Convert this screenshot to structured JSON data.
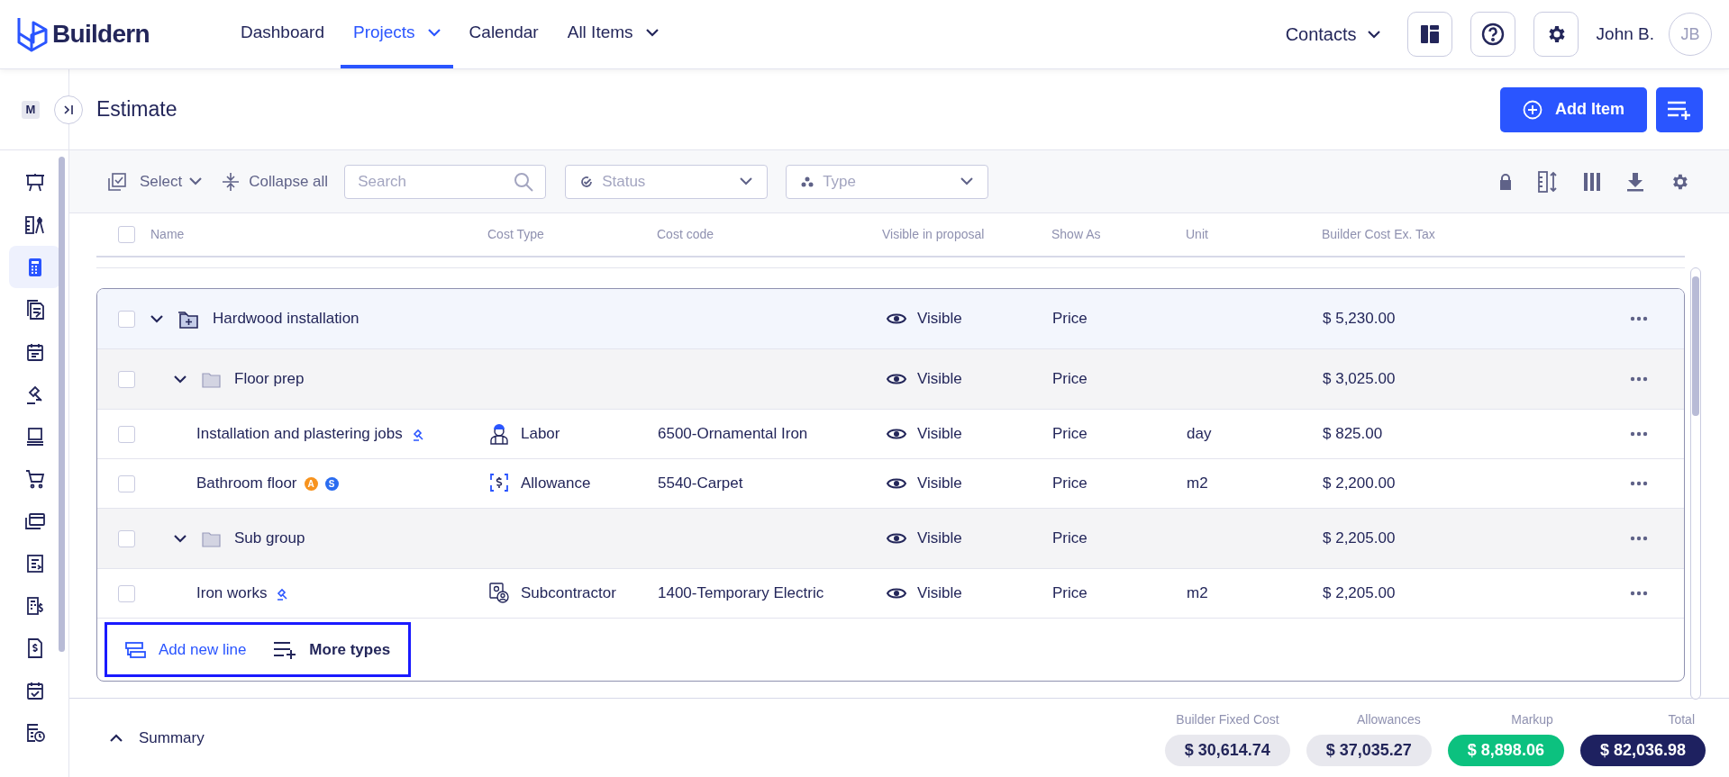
{
  "app": {
    "logo": "Buildern"
  },
  "nav": [
    {
      "label": "Dashboard",
      "selected": false,
      "dropdown": false
    },
    {
      "label": "Projects",
      "selected": true,
      "dropdown": true
    },
    {
      "label": "Calendar",
      "selected": false,
      "dropdown": false
    },
    {
      "label": "All Items",
      "selected": false,
      "dropdown": true
    }
  ],
  "header_right": {
    "contacts": "Contacts",
    "user_name": "John B.",
    "avatar_initials": "JB"
  },
  "page": {
    "badge": "M",
    "title": "Estimate",
    "add_item": "Add Item"
  },
  "sidebar": {
    "items": [
      {
        "kind": "presentation",
        "selected": false
      },
      {
        "kind": "blueprint",
        "selected": false
      },
      {
        "kind": "calculator",
        "selected": true
      },
      {
        "kind": "documents",
        "selected": false
      },
      {
        "kind": "calendar",
        "selected": false
      },
      {
        "kind": "gavel",
        "selected": false
      },
      {
        "kind": "laptop",
        "selected": false
      },
      {
        "kind": "cart",
        "selected": false
      },
      {
        "kind": "cards",
        "selected": false
      },
      {
        "kind": "invoice",
        "selected": false
      },
      {
        "kind": "bill",
        "selected": false
      },
      {
        "kind": "dollar-doc",
        "selected": false
      },
      {
        "kind": "calendar-check",
        "selected": false
      },
      {
        "kind": "schedule",
        "selected": false
      }
    ]
  },
  "toolbar": {
    "select": "Select",
    "collapse_all": "Collapse all",
    "search": {
      "placeholder": "Search"
    },
    "status": {
      "placeholder": "Status"
    },
    "type": {
      "placeholder": "Type"
    }
  },
  "table": {
    "all_checked": false,
    "columns": [
      "Name",
      "Cost Type",
      "Cost code",
      "Visible in proposal",
      "Show As",
      "Unit",
      "Builder Cost Ex. Tax"
    ],
    "rows": [
      {
        "kind": "group",
        "checked": false,
        "expanded": true,
        "name": "Hardwood installation",
        "visibility": "Visible",
        "show_as": "Price",
        "cost": "$ 5,230.00",
        "children": [
          {
            "kind": "subgroup",
            "checked": false,
            "expanded": true,
            "name": "Floor prep",
            "visibility": "Visible",
            "show_as": "Price",
            "cost": "$ 3,025.00",
            "children": [
              {
                "kind": "item",
                "checked": false,
                "name": "Installation and plastering jobs",
                "bid_marker": true,
                "cost_type": {
                  "kind": "labor",
                  "label": "Labor"
                },
                "cost_code": "6500-Ornamental Iron",
                "visibility": "Visible",
                "show_as": "Price",
                "unit": "day",
                "cost": "$ 825.00"
              },
              {
                "kind": "item",
                "checked": false,
                "name": "Bathroom floor",
                "bid_marker": false,
                "badges": [
                  {
                    "label": "A",
                    "color": "#f7931e"
                  },
                  {
                    "label": "S",
                    "color": "#2a6cf0"
                  }
                ],
                "cost_type": {
                  "kind": "allowance",
                  "label": "Allowance"
                },
                "cost_code": "5540-Carpet",
                "visibility": "Visible",
                "show_as": "Price",
                "unit": "m2",
                "cost": "$ 2,200.00"
              }
            ]
          },
          {
            "kind": "subgroup",
            "checked": false,
            "expanded": true,
            "name": "Sub group",
            "visibility": "Visible",
            "show_as": "Price",
            "cost": "$ 2,205.00",
            "children": [
              {
                "kind": "item",
                "checked": false,
                "name": "Iron works",
                "bid_marker": true,
                "cost_type": {
                  "kind": "subcontractor",
                  "label": "Subcontractor"
                },
                "cost_code": "1400-Temporary Electric",
                "visibility": "Visible",
                "show_as": "Price",
                "unit": "m2",
                "cost": "$ 2,205.00"
              }
            ]
          }
        ]
      }
    ],
    "actions": [
      {
        "kind": "add-line",
        "label": "Add new line"
      },
      {
        "kind": "more-types",
        "label": "More types"
      }
    ]
  },
  "summary": {
    "label": "Summary",
    "totals": [
      {
        "kind": "neutral",
        "label": "Builder Fixed Cost",
        "value": "$ 30,614.74"
      },
      {
        "kind": "neutral",
        "label": "Allowances",
        "value": "$ 37,035.27"
      },
      {
        "kind": "positive",
        "label": "Markup",
        "value": "$ 8,898.06"
      },
      {
        "kind": "total",
        "label": "Total",
        "value": "$ 82,036.98"
      }
    ]
  }
}
